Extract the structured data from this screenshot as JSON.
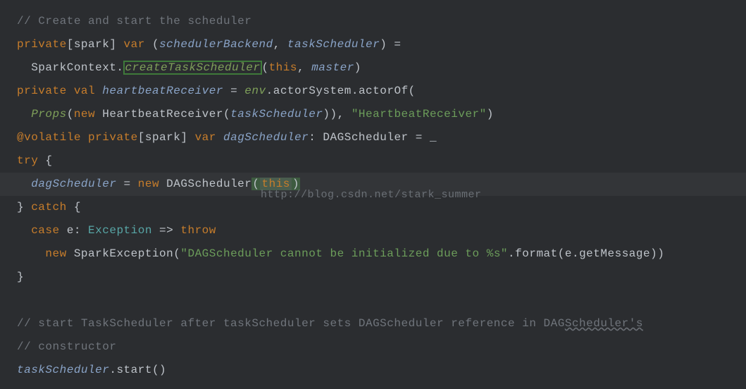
{
  "watermark": "http://blog.csdn.net/stark_summer",
  "code": {
    "l1_comment": "// Create and start the scheduler",
    "l2": {
      "kw_private": "private",
      "lb": "[",
      "spark": "spark",
      "rb": "] ",
      "kw_var": "var",
      "sp1": " (",
      "schedulerBackend": "schedulerBackend",
      "comma1": ", ",
      "taskScheduler": "taskScheduler",
      "close": ") ="
    },
    "l3": {
      "indent": "  ",
      "sparkContext": "SparkContext",
      "dot": ".",
      "createTaskScheduler": "createTaskScheduler",
      "open": "(",
      "this": "this",
      "comma": ", ",
      "master": "master",
      "close": ")"
    },
    "l4": {
      "kw_private": "private",
      "sp": " ",
      "kw_val": "val",
      "sp2": " ",
      "heartbeatReceiver": "heartbeatReceiver",
      "eq": " = ",
      "env": "env",
      "dot1": ".",
      "actorSystem": "actorSystem",
      "dot2": ".",
      "actorOf": "actorOf",
      "open": "("
    },
    "l5": {
      "indent": "  ",
      "props": "Props",
      "open1": "(",
      "kw_new": "new",
      "sp": " ",
      "hb": "HeartbeatReceiver",
      "open2": "(",
      "taskScheduler": "taskScheduler",
      "close2": "))",
      "comma": ", ",
      "str": "\"HeartbeatReceiver\"",
      "close3": ")"
    },
    "l6": {
      "at": "@",
      "volatile": "volatile",
      "sp": " ",
      "kw_private": "private",
      "lb": "[",
      "spark": "spark",
      "rb": "] ",
      "kw_var": "var",
      "sp2": " ",
      "dagScheduler": "dagScheduler",
      "colon": ": ",
      "type": "DAGScheduler",
      "eq": " = ",
      "under": "_"
    },
    "l7": {
      "kw_try": "try",
      "brace": " {"
    },
    "l8": {
      "indent": "  ",
      "dagScheduler": "dagScheduler",
      "eq": " = ",
      "kw_new": "new",
      "sp": " ",
      "cls": "DAGScheduler",
      "open": "(",
      "this": "this",
      "close": ")"
    },
    "l9": {
      "brace": "} ",
      "kw_catch": "catch",
      "brace2": " {"
    },
    "l10": {
      "indent": "  ",
      "kw_case": "case",
      "sp": " ",
      "e": "e",
      "colon": ": ",
      "type": "Exception",
      "arrow": " => ",
      "kw_throw": "throw"
    },
    "l11": {
      "indent": "    ",
      "kw_new": "new",
      "sp": " ",
      "cls": "SparkException",
      "open": "(",
      "str": "\"DAGScheduler cannot be initialized due to %s\"",
      "dot": ".",
      "format": "format",
      "open2": "(",
      "e": "e",
      "dot2": ".",
      "getMessage": "getMessage",
      "close2": "))"
    },
    "l12_brace": "}",
    "l13_blank": "",
    "l14_comment": "// start TaskScheduler after taskScheduler sets DAGScheduler reference in DAG",
    "l14_wavy": "Scheduler's",
    "l15_comment": "// constructor",
    "l16": {
      "taskScheduler": "taskScheduler",
      "dot": ".",
      "start": "start",
      "parens": "()"
    }
  }
}
